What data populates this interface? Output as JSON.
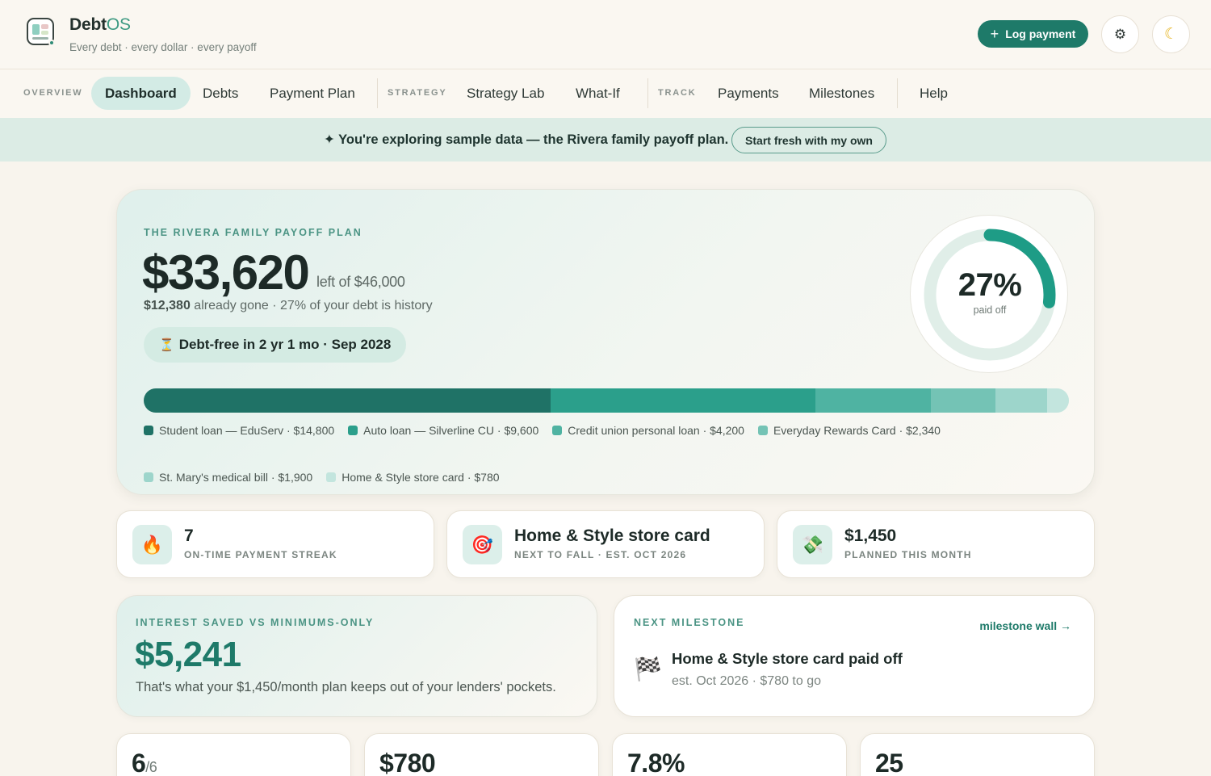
{
  "app": {
    "name_main": "Debt",
    "name_accent": "OS",
    "tagline": "Every debt · every dollar · every payoff",
    "log_payment_label": "Log payment",
    "settings_icon": "gear-icon",
    "theme_icon": "moon-icon"
  },
  "nav": {
    "overview_label": "OVERVIEW",
    "strategy_label": "STRATEGY",
    "track_label": "TRACK",
    "items": {
      "dashboard": "Dashboard",
      "debts": "Debts",
      "payment_plan": "Payment Plan",
      "strategy_lab": "Strategy Lab",
      "what_if": "What-If",
      "payments": "Payments",
      "milestones": "Milestones",
      "help": "Help"
    }
  },
  "banner": {
    "text": "✦ You're exploring sample data — the Rivera family payoff plan.",
    "button": "Start fresh with my own"
  },
  "hero": {
    "label": "THE RIVERA FAMILY PAYOFF PLAN",
    "amount": "$33,620",
    "of_text": "left of $46,000",
    "gone_amount": "$12,380",
    "gone_text": " already gone · 27% of your debt is history",
    "pill_icon": "⏳",
    "pill_text": "Debt-free in 2 yr 1 mo · Sep 2028",
    "percent_text": "27%",
    "percent_value": 0.27,
    "percent_sub": "paid off",
    "accent_color": "#1e9c86",
    "debts": [
      {
        "label": "Student loan — EduServ · $14,800",
        "value": 14800,
        "color": "#1f7266"
      },
      {
        "label": "Auto loan — Silverline CU · $9,600",
        "value": 9600,
        "color": "#2b9f8b"
      },
      {
        "label": "Credit union personal loan · $4,200",
        "value": 4200,
        "color": "#4fb3a2"
      },
      {
        "label": "Everyday Rewards Card · $2,340",
        "value": 2340,
        "color": "#74c3b5"
      },
      {
        "label": "St. Mary's medical bill · $1,900",
        "value": 1900,
        "color": "#9dd5cb"
      },
      {
        "label": "Home & Style store card · $780",
        "value": 780,
        "color": "#c3e5de"
      }
    ]
  },
  "stats": [
    {
      "icon": "🔥",
      "icon_name": "fire-icon",
      "value": "7",
      "label": "ON-TIME PAYMENT STREAK"
    },
    {
      "icon": "🎯",
      "icon_name": "target-icon",
      "value": "Home & Style store card",
      "label": "NEXT TO FALL · EST. OCT 2026"
    },
    {
      "icon": "💸",
      "icon_name": "money-icon",
      "value": "$1,450",
      "label": "PLANNED THIS MONTH"
    }
  ],
  "interest": {
    "label": "INTEREST SAVED VS MINIMUMS-ONLY",
    "amount": "$5,241",
    "note": "That's what your $1,450/month plan keeps out of your lenders' pockets."
  },
  "milestone": {
    "label": "NEXT MILESTONE",
    "link": "milestone wall →",
    "flag": "🏁",
    "title": "Home & Style store card paid off",
    "sub": "est. Oct 2026 · $780 to go"
  },
  "minis": [
    {
      "value": "6",
      "den": "/6"
    },
    {
      "value": "$780",
      "den": ""
    },
    {
      "value": "7.8%",
      "den": ""
    },
    {
      "value": "25",
      "den": ""
    }
  ]
}
